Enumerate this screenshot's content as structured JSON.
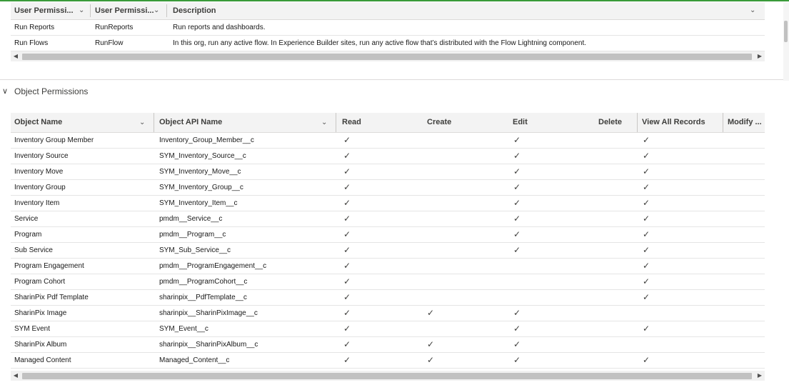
{
  "user_permissions": {
    "columns": [
      {
        "label": "User Permissi..."
      },
      {
        "label": "User Permissi..."
      },
      {
        "label": "Description"
      }
    ],
    "rows": [
      {
        "name": "Run Reports",
        "api": "RunReports",
        "description": "Run reports and dashboards."
      },
      {
        "name": "Run Flows",
        "api": "RunFlow",
        "description": "In this org, run any active flow. In Experience Builder sites, run any active flow that’s distributed with the Flow Lightning component."
      }
    ]
  },
  "object_section": {
    "label": "Object Permissions"
  },
  "object_permissions": {
    "columns": [
      {
        "label": "Object Name"
      },
      {
        "label": "Object API Name"
      },
      {
        "label": "Read"
      },
      {
        "label": "Create"
      },
      {
        "label": "Edit"
      },
      {
        "label": "Delete"
      },
      {
        "label": "View All Records"
      },
      {
        "label": "Modify ..."
      }
    ],
    "check_glyph": "✓",
    "rows": [
      {
        "name": "Inventory Group Member",
        "api": "Inventory_Group_Member__c",
        "read": true,
        "create": false,
        "edit": true,
        "delete": false,
        "view_all": true
      },
      {
        "name": "Inventory Source",
        "api": "SYM_Inventory_Source__c",
        "read": true,
        "create": false,
        "edit": true,
        "delete": false,
        "view_all": true
      },
      {
        "name": "Inventory Move",
        "api": "SYM_Inventory_Move__c",
        "read": true,
        "create": false,
        "edit": true,
        "delete": false,
        "view_all": true
      },
      {
        "name": "Inventory Group",
        "api": "SYM_Inventory_Group__c",
        "read": true,
        "create": false,
        "edit": true,
        "delete": false,
        "view_all": true
      },
      {
        "name": "Inventory Item",
        "api": "SYM_Inventory_Item__c",
        "read": true,
        "create": false,
        "edit": true,
        "delete": false,
        "view_all": true
      },
      {
        "name": "Service",
        "api": "pmdm__Service__c",
        "read": true,
        "create": false,
        "edit": true,
        "delete": false,
        "view_all": true
      },
      {
        "name": "Program",
        "api": "pmdm__Program__c",
        "read": true,
        "create": false,
        "edit": true,
        "delete": false,
        "view_all": true
      },
      {
        "name": "Sub Service",
        "api": "SYM_Sub_Service__c",
        "read": true,
        "create": false,
        "edit": true,
        "delete": false,
        "view_all": true
      },
      {
        "name": "Program Engagement",
        "api": "pmdm__ProgramEngagement__c",
        "read": true,
        "create": false,
        "edit": false,
        "delete": false,
        "view_all": true
      },
      {
        "name": "Program Cohort",
        "api": "pmdm__ProgramCohort__c",
        "read": true,
        "create": false,
        "edit": false,
        "delete": false,
        "view_all": true
      },
      {
        "name": "SharinPix Pdf Template",
        "api": "sharinpix__PdfTemplate__c",
        "read": true,
        "create": false,
        "edit": false,
        "delete": false,
        "view_all": true
      },
      {
        "name": "SharinPix Image",
        "api": "sharinpix__SharinPixImage__c",
        "read": true,
        "create": true,
        "edit": true,
        "delete": false,
        "view_all": false
      },
      {
        "name": "SYM Event",
        "api": "SYM_Event__c",
        "read": true,
        "create": false,
        "edit": true,
        "delete": false,
        "view_all": true
      },
      {
        "name": "SharinPix Album",
        "api": "sharinpix__SharinPixAlbum__c",
        "read": true,
        "create": true,
        "edit": true,
        "delete": false,
        "view_all": false
      },
      {
        "name": "Managed Content",
        "api": "Managed_Content__c",
        "read": true,
        "create": true,
        "edit": true,
        "delete": false,
        "view_all": true
      }
    ]
  },
  "scroll": {
    "left_arrow": "◀",
    "right_arrow": "▶"
  },
  "chevron": "⌄",
  "section_chevron": "∨"
}
